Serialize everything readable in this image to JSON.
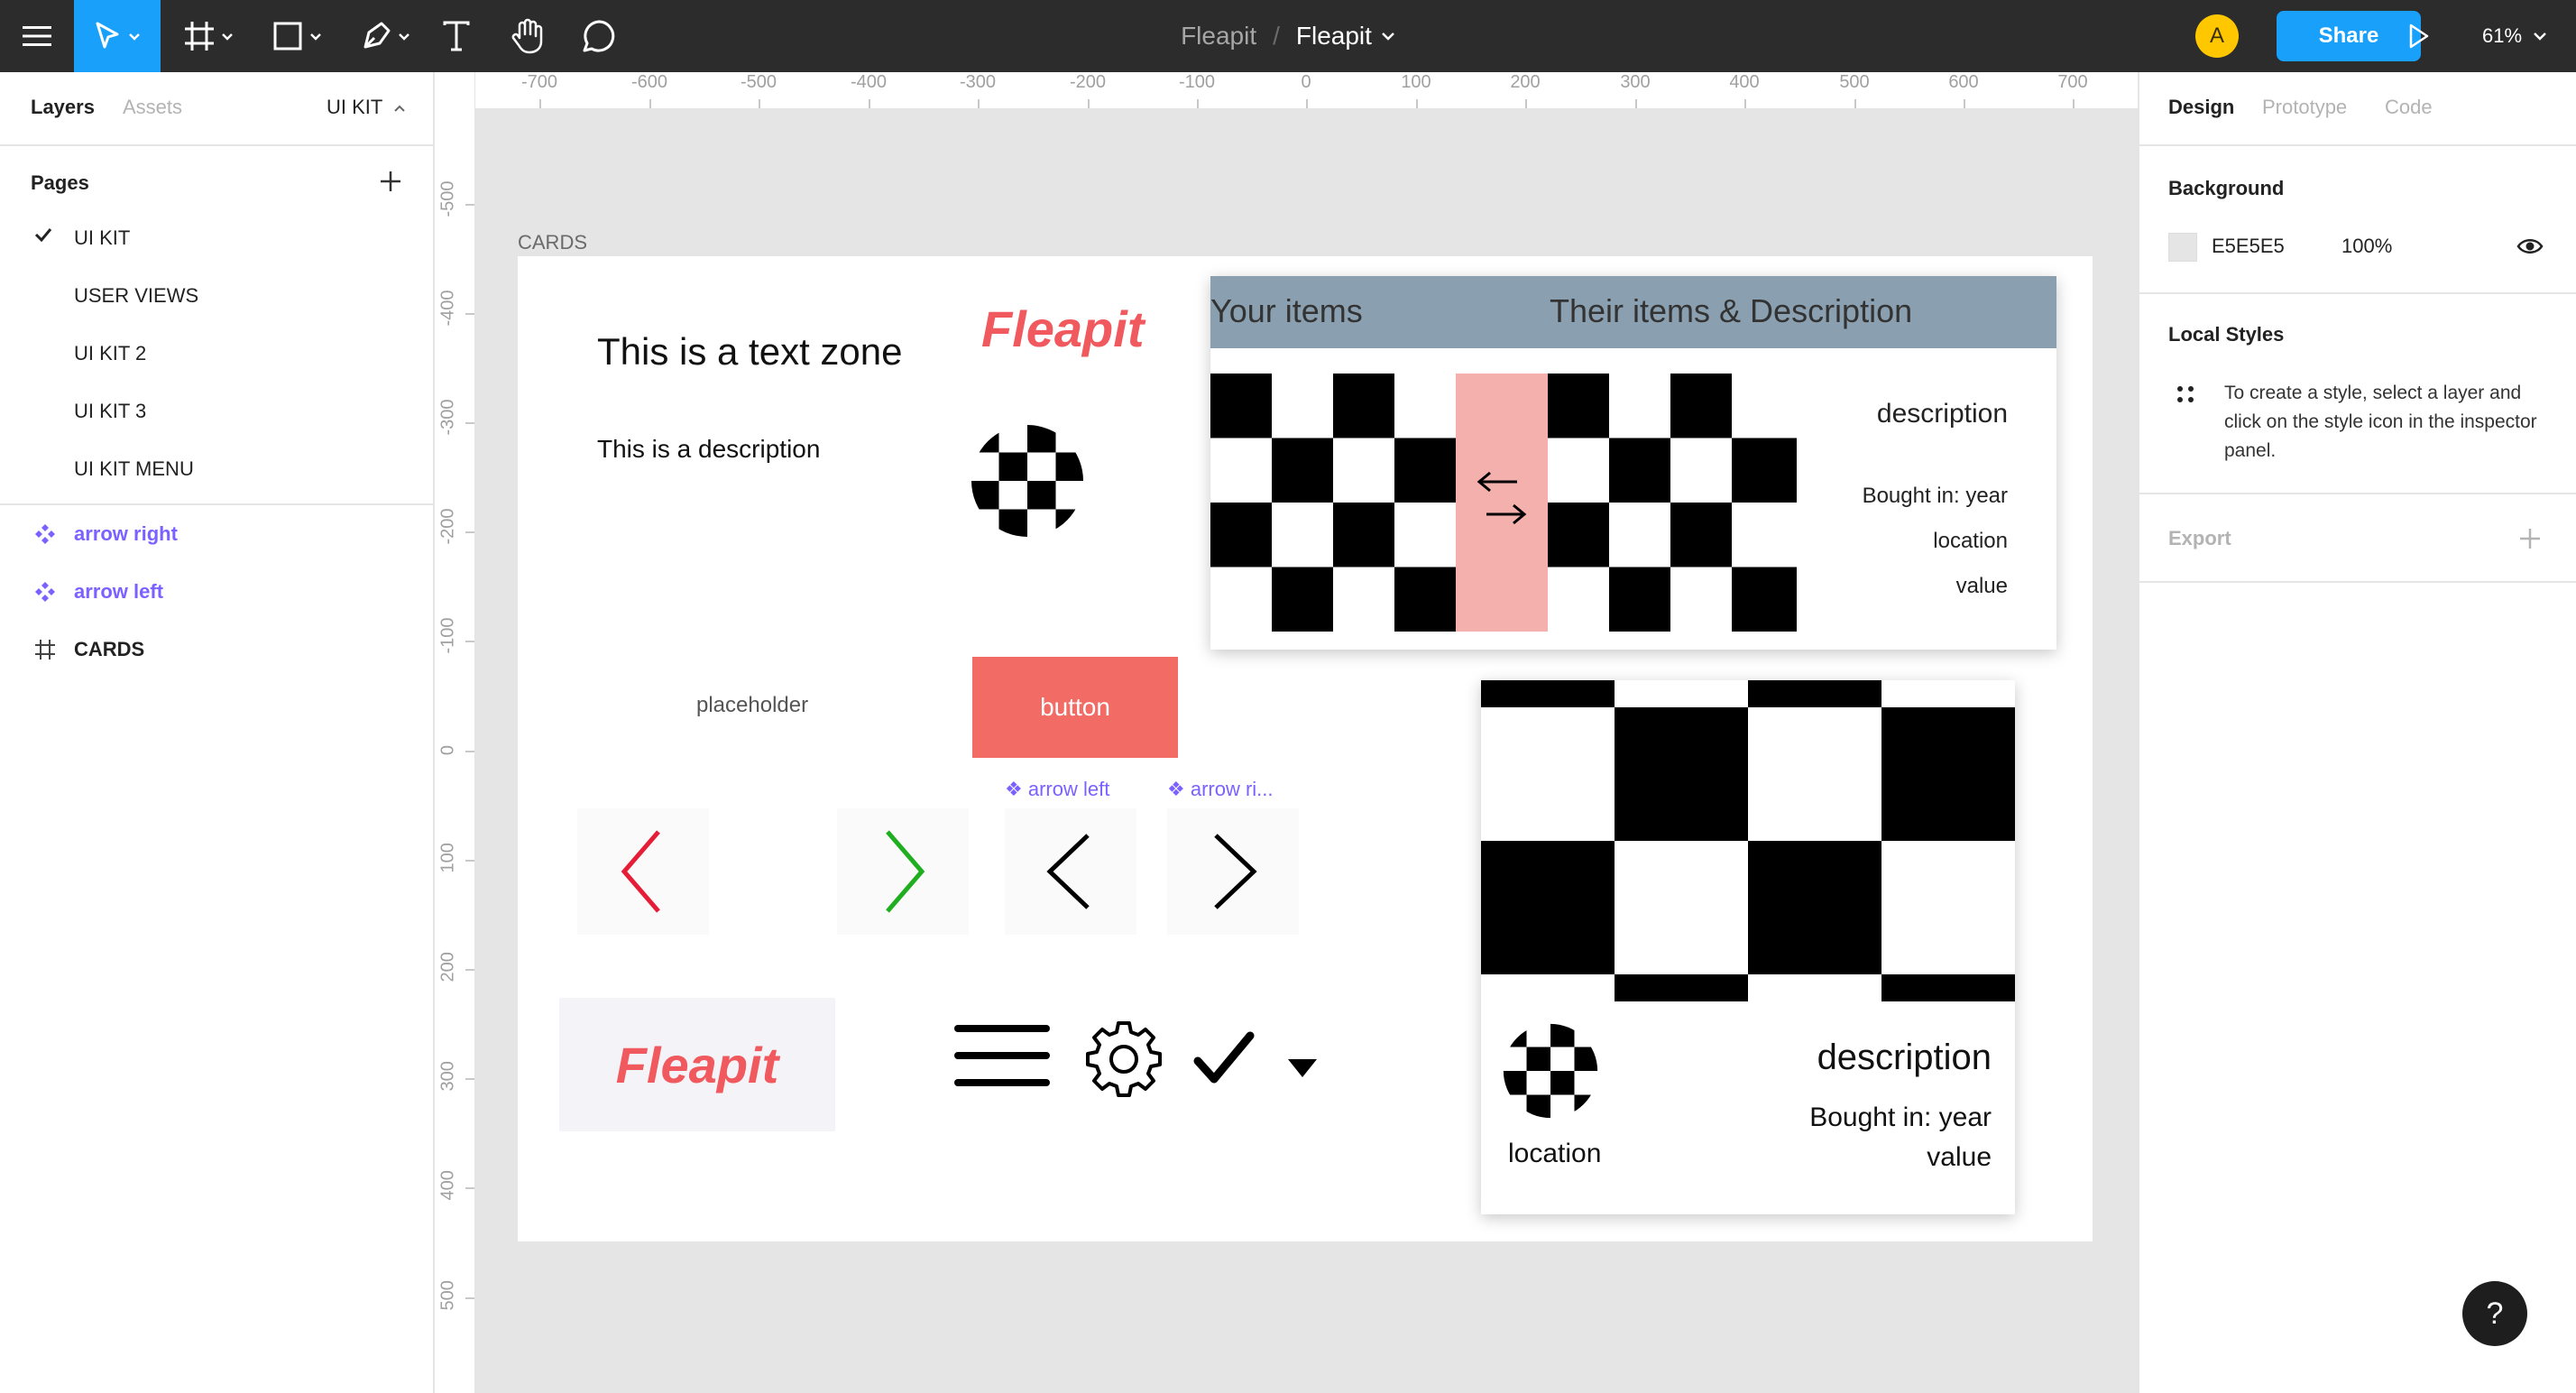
{
  "toolbar": {
    "project": "Fleapit",
    "separator": "/",
    "file_name": "Fleapit",
    "avatar_initial": "A",
    "share_label": "Share",
    "zoom": "61%"
  },
  "left_panel": {
    "tabs": [
      "Layers",
      "Assets"
    ],
    "current_page_selector": "UI KIT",
    "pages_heading": "Pages",
    "pages": [
      "UI KIT",
      "USER VIEWS",
      "UI KIT 2",
      "UI KIT 3",
      "UI KIT MENU"
    ],
    "layers": [
      {
        "label": "arrow right",
        "type": "component"
      },
      {
        "label": "arrow left",
        "type": "component"
      },
      {
        "label": "CARDS",
        "type": "frame"
      }
    ]
  },
  "rulers": {
    "horizontal": [
      "-700",
      "-600",
      "-500",
      "-400",
      "-300",
      "-200",
      "-100",
      "0",
      "100",
      "200",
      "300",
      "400",
      "500",
      "600",
      "700"
    ],
    "vertical": [
      "-500",
      "-400",
      "-300",
      "-200",
      "-100",
      "0",
      "100",
      "200",
      "300",
      "400",
      "500"
    ]
  },
  "canvas": {
    "frame_label": "CARDS",
    "text_zone": "This is a text zone",
    "description": "This is a description",
    "logo_text": "Fleapit",
    "placeholder": "placeholder",
    "button_label": "button",
    "arrow_left_label": "arrow left",
    "arrow_right_label": "arrow ri...",
    "card1": {
      "header_left": "Your items",
      "header_right": "Their items & Description",
      "description": "description",
      "bought": "Bought in: year",
      "location": "location",
      "value": "value"
    },
    "card2": {
      "description": "description",
      "bought": "Bought in: year",
      "location": "location",
      "value": "value"
    }
  },
  "right_panel": {
    "tabs": [
      "Design",
      "Prototype",
      "Code"
    ],
    "background_heading": "Background",
    "background_hex": "E5E5E5",
    "background_opacity": "100%",
    "local_styles_heading": "Local Styles",
    "local_styles_hint": "To create a style, select a layer and click on the style icon in the inspector panel.",
    "export_heading": "Export"
  },
  "help": "?",
  "colors": {
    "toolbar": "#2c2c2c",
    "accent": "#18a0fb",
    "component": "#7b61ff",
    "brand_red": "#f0595e",
    "card_header": "#8aa0b0",
    "pink_strip": "#f4b0ad",
    "arrow_red": "#e51d36",
    "arrow_green": "#1fae1f"
  }
}
